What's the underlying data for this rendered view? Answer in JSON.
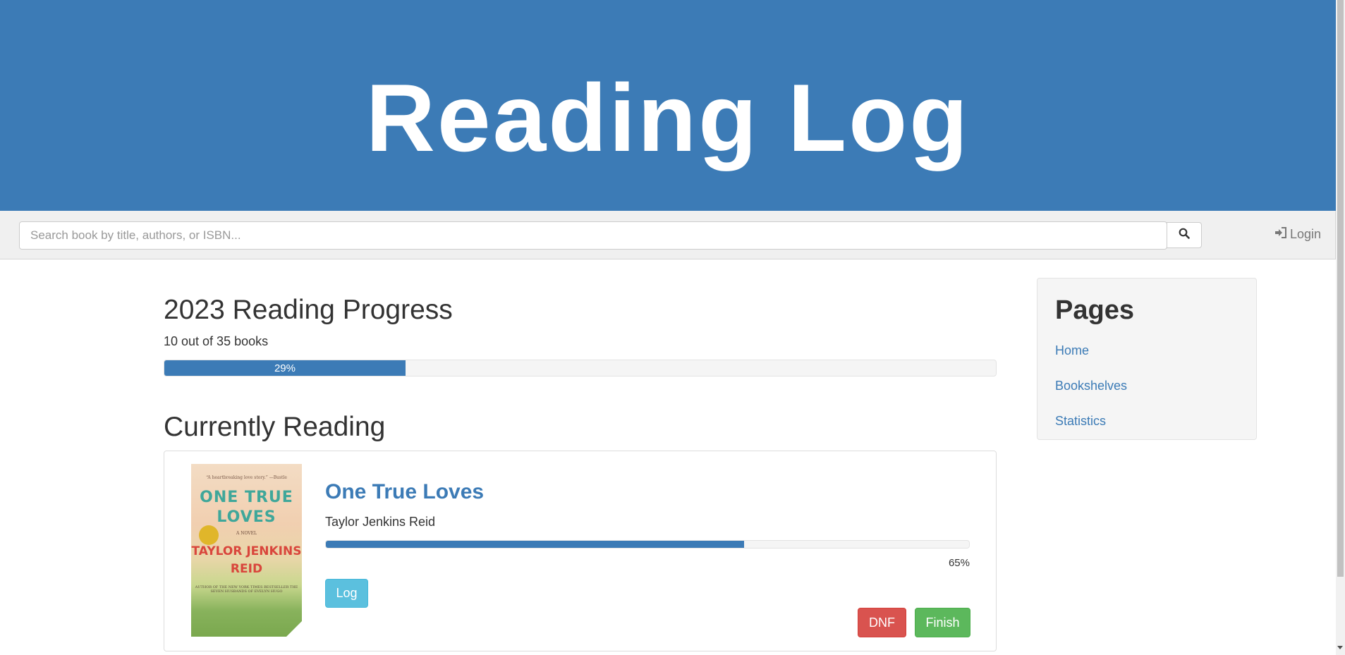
{
  "header": {
    "title": "Reading Log"
  },
  "navbar": {
    "search_placeholder": "Search book by title, authors, or ISBN...",
    "login_label": "Login"
  },
  "year_progress": {
    "heading": "2023 Reading Progress",
    "count_text": "10 out of 35 books",
    "percent_label": "29%",
    "fraction": 0.29
  },
  "currently_reading": {
    "heading": "Currently Reading",
    "books": [
      {
        "title": "One True Loves",
        "author": "Taylor Jenkins Reid",
        "progress_fraction": 0.65,
        "percent_label": "65%",
        "cover": {
          "quote": "“A heartbreaking love story.” —Bustle",
          "title": "ONE TRUE LOVES",
          "subtitle": "A NOVEL",
          "author": "TAYLOR JENKINS REID",
          "byline": "AUTHOR OF THE NEW YORK TIMES BESTSELLER THE SEVEN HUSBANDS OF EVELYN HUGO"
        },
        "log_label": "Log",
        "dnf_label": "DNF",
        "finish_label": "Finish"
      }
    ]
  },
  "sidebar": {
    "heading": "Pages",
    "links": [
      {
        "label": "Home"
      },
      {
        "label": "Bookshelves"
      },
      {
        "label": "Statistics"
      }
    ]
  },
  "colors": {
    "primary": "#3c7bb6",
    "info": "#5bc0de",
    "danger": "#d9534f",
    "success": "#5cb85c"
  }
}
